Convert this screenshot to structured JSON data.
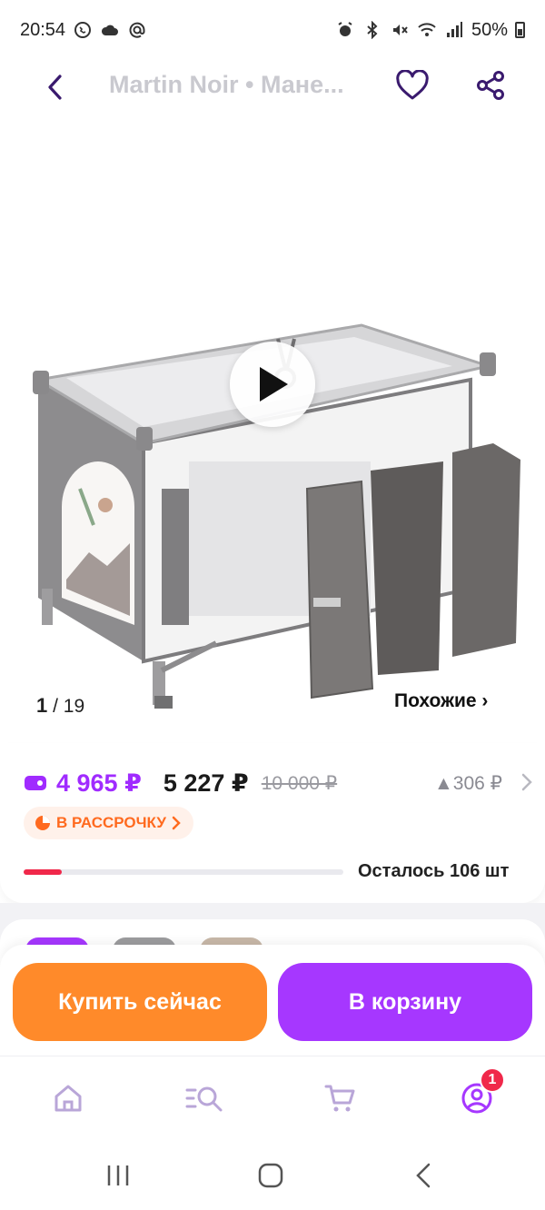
{
  "status_bar": {
    "time": "20:54",
    "battery": "50%"
  },
  "header": {
    "title": "Martin Noir • Мане..."
  },
  "gallery": {
    "current": "1",
    "total": "/ 19",
    "similar_label": "Похожие ›"
  },
  "price": {
    "card_price": "4 965 ₽",
    "main_price": "5 227 ₽",
    "old_price": "10 000 ₽",
    "change": "▲306 ₽",
    "installment_label": "В РАССРОЧКУ"
  },
  "stock": {
    "text": "Осталось 106 шт",
    "level": 0.12
  },
  "actions": {
    "buy_now": "Купить сейчас",
    "add_to_cart": "В корзину"
  },
  "tabs": {
    "profile_badge": "1"
  },
  "colors": {
    "purple": "#a637ff",
    "orange": "#ff8a2a",
    "red": "#f0284a"
  }
}
